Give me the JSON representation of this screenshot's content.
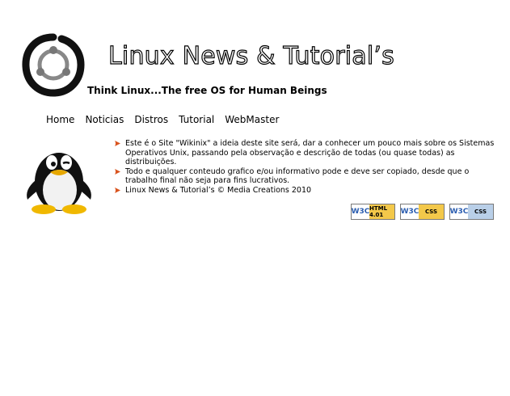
{
  "header": {
    "title": "Linux News & Tutorial’s",
    "tagline": "Think Linux...The free OS for Human Beings"
  },
  "nav": {
    "items": [
      "Home",
      "Noticias",
      "Distros",
      "Tutorial",
      "WebMaster"
    ]
  },
  "content": {
    "bullets": [
      "Este é o Site \"Wikinix\" a ideia deste site será, dar a conhecer um pouco mais sobre os Sistemas Operativos Unix, passando pela observação e descrição de todas (ou quase todas) as distribuições.",
      "Todo e qualquer conteudo grafico e/ou informativo pode e deve ser copiado, desde que o trabalho final não seja para fins lucrativos.",
      "Linux News & Tutorial’s © Media Creations 2010"
    ]
  },
  "badges": [
    {
      "org": "W3C",
      "label": "HTML 4.01"
    },
    {
      "org": "W3C",
      "label": "CSS"
    },
    {
      "org": "W3C",
      "label": "CSS"
    }
  ],
  "colors": {
    "bullet": "#d9541f",
    "w3c_blue": "#2a5db0",
    "badge_gold": "#f3c84a",
    "badge_blue": "#b9cfe8"
  }
}
